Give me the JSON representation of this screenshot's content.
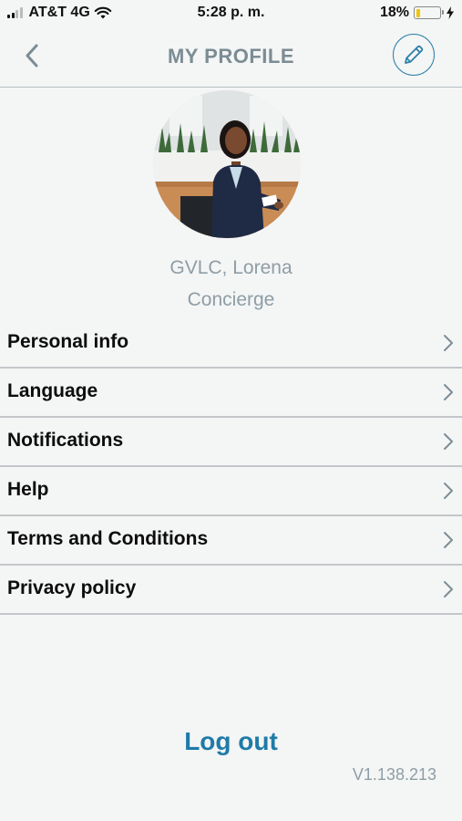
{
  "status_bar": {
    "carrier": "AT&T 4G",
    "time": "5:28 p. m.",
    "battery_percent": "18%",
    "battery_level": 0.18,
    "signal_icon": "signal-icon",
    "wifi_icon": "wifi-icon",
    "battery_icon": "battery-icon",
    "charging_icon": "charging-bolt-icon"
  },
  "header": {
    "title": "MY PROFILE",
    "back_icon": "chevron-left-icon",
    "edit_icon": "pencil-icon"
  },
  "profile": {
    "name": "GVLC, Lorena",
    "role": "Concierge"
  },
  "menu": {
    "items": [
      {
        "label": "Personal info"
      },
      {
        "label": "Language"
      },
      {
        "label": "Notifications"
      },
      {
        "label": "Help"
      },
      {
        "label": "Terms and Conditions"
      },
      {
        "label": "Privacy policy"
      }
    ],
    "chevron_icon": "chevron-right-icon"
  },
  "footer": {
    "logout_label": "Log out",
    "version": "V1.138.213"
  },
  "colors": {
    "accent": "#1e7ba8",
    "muted_text": "#8e9ea5",
    "background": "#f4f5f5",
    "divider": "#c3c7c9"
  }
}
